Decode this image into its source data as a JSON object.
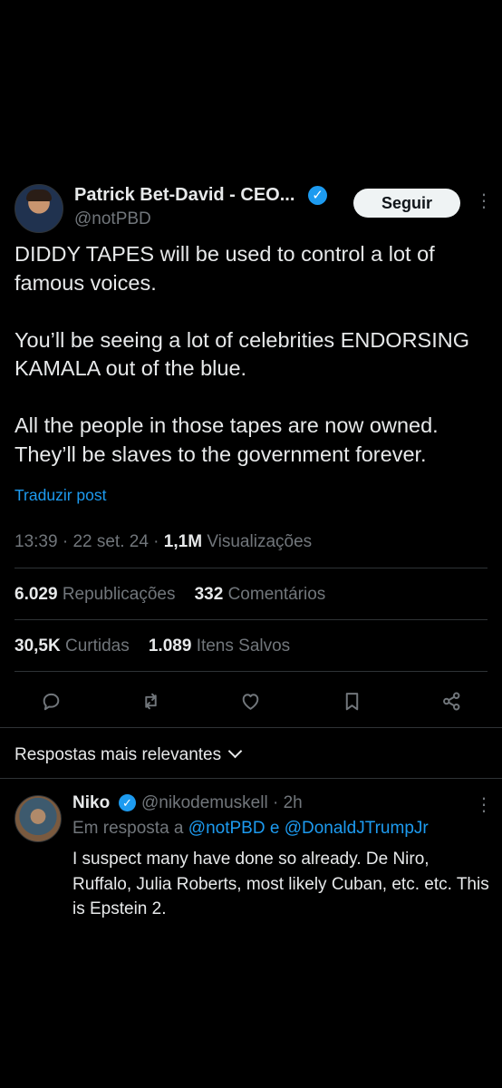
{
  "tweet": {
    "author_name": "Patrick Bet-David - CEO...",
    "handle": "@notPBD",
    "follow_label": "Seguir",
    "text": "DIDDY TAPES will be used to control a lot of famous voices.\n\nYou’ll be seeing a lot of celebrities ENDORSING KAMALA out of the blue.\n\nAll the people in those tapes are now owned. They’ll be slaves to the government forever.",
    "translate_label": "Traduzir post",
    "time": "13:39",
    "date": "22 set. 24",
    "views_count": "1,1M",
    "views_label": "Visualizações"
  },
  "stats": {
    "reposts_count": "6.029",
    "reposts_label": "Republicações",
    "comments_count": "332",
    "comments_label": "Comentários",
    "likes_count": "30,5K",
    "likes_label": "Curtidas",
    "saves_count": "1.089",
    "saves_label": "Itens Salvos"
  },
  "actions": [
    "reply-icon",
    "repost-icon",
    "like-icon",
    "bookmark-icon",
    "share-icon"
  ],
  "replies_header": {
    "sort_label": "Respostas mais relevantes"
  },
  "reply": {
    "name": "Niko",
    "handle": "@nikodemuskell",
    "age": "2h",
    "in_reply_prefix": "Em resposta a",
    "mention_1": "@notPBD",
    "conjunction": "e",
    "mention_2": "@DonaldJTrumpJr",
    "text": "I suspect many have done so already. De Niro, Ruffalo, Julia Roberts, most likely Cuban, etc. etc. This is Epstein 2."
  },
  "colors": {
    "background": "#000000",
    "text": "#e7e9ea",
    "secondary": "#71767b",
    "accent": "#1d9bf0",
    "divider": "#2f3336"
  }
}
